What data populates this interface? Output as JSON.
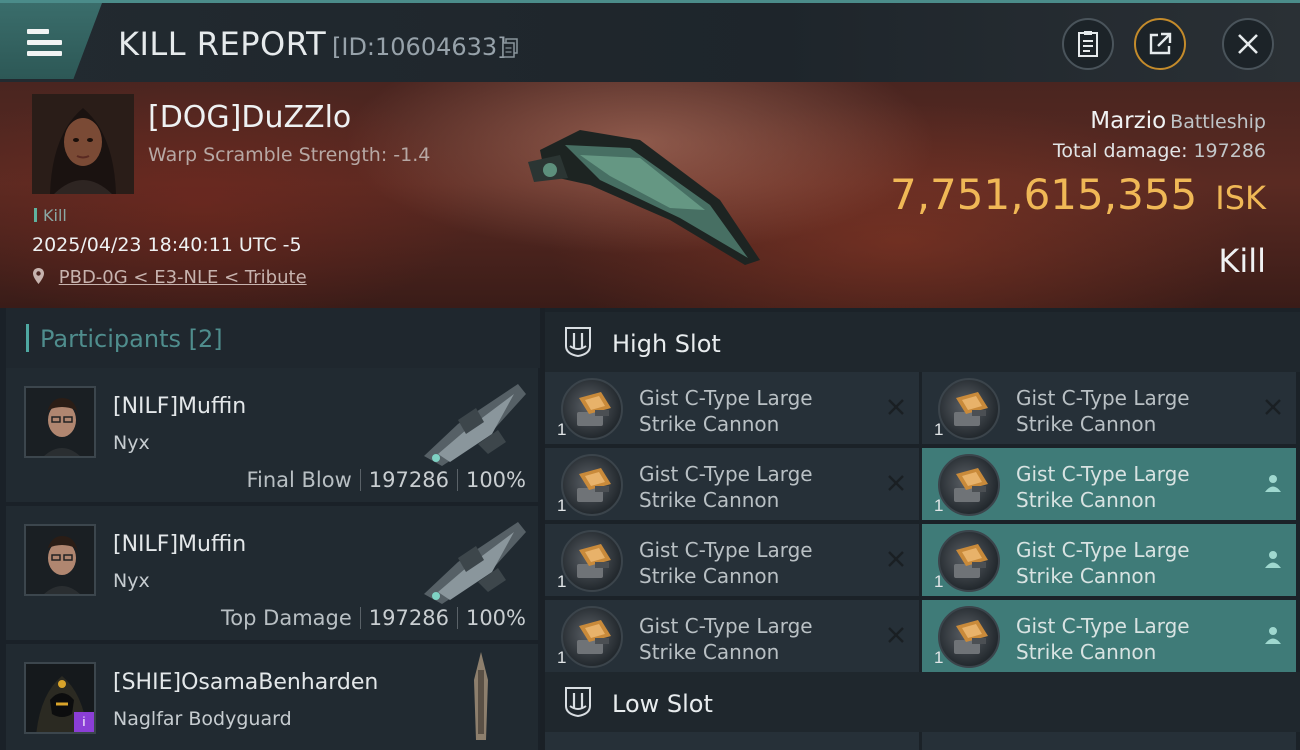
{
  "header": {
    "title": "KILL REPORT",
    "report_id": "[ID:10604633]"
  },
  "victim": {
    "pilot": "[DOG]DuZZlo",
    "warp_scramble": "Warp Scramble Strength: -1.4",
    "tag": "Kill",
    "datetime": "2025/04/23 18:40:11 UTC -5",
    "location": "PBD-0G < E3-NLE < Tribute",
    "ship_name": "Marzio",
    "ship_class": "Battleship",
    "total_damage_label": "Total damage:",
    "total_damage": "197286",
    "isk_value": "7,751,615,355",
    "isk_unit": "ISK",
    "result": "Kill"
  },
  "participants": {
    "title": "Participants",
    "count": "[2]",
    "rows": [
      {
        "name": "[NILF]Muffin",
        "ship": "Nyx",
        "role": "Final Blow",
        "damage": "197286",
        "percent": "100%"
      },
      {
        "name": "[NILF]Muffin",
        "ship": "Nyx",
        "role": "Top Damage",
        "damage": "197286",
        "percent": "100%"
      },
      {
        "name": "[SHIE]OsamaBenharden",
        "ship": "Naglfar Bodyguard",
        "badge": "i"
      }
    ]
  },
  "slots": {
    "high_title": "High Slot",
    "low_title": "Low Slot",
    "high_modules": [
      {
        "line1": "Gist C-Type Large",
        "line2": "Strike Cannon",
        "qty": "1",
        "status": "destroyed"
      },
      {
        "line1": "Gist C-Type Large",
        "line2": "Strike Cannon",
        "qty": "1",
        "status": "destroyed"
      },
      {
        "line1": "Gist C-Type Large",
        "line2": "Strike Cannon",
        "qty": "1",
        "status": "destroyed"
      },
      {
        "line1": "Gist C-Type Large",
        "line2": "Strike Cannon",
        "qty": "1",
        "status": "dropped"
      },
      {
        "line1": "Gist C-Type Large",
        "line2": "Strike Cannon",
        "qty": "1",
        "status": "destroyed"
      },
      {
        "line1": "Gist C-Type Large",
        "line2": "Strike Cannon",
        "qty": "1",
        "status": "dropped"
      },
      {
        "line1": "Gist C-Type Large",
        "line2": "Strike Cannon",
        "qty": "1",
        "status": "destroyed"
      },
      {
        "line1": "Gist C-Type Large",
        "line2": "Strike Cannon",
        "qty": "1",
        "status": "dropped"
      }
    ]
  },
  "colors": {
    "accent_teal": "#4fa8a2",
    "isk_gold": "#f0b856",
    "dropped_bg": "#3f7b78"
  }
}
